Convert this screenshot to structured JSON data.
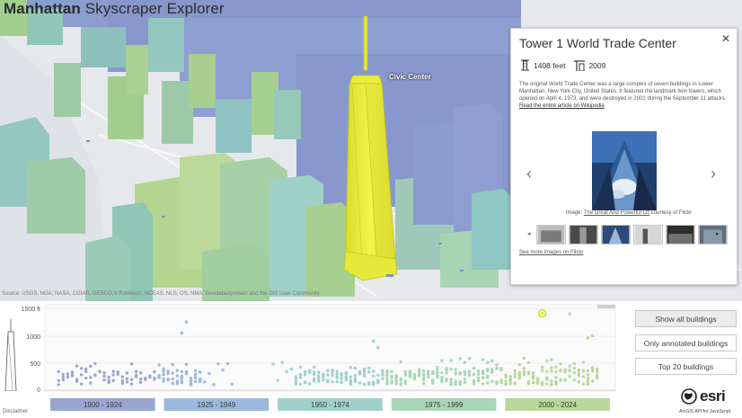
{
  "header": {
    "title_bold": "Manhattan",
    "title_rest": "Skyscraper Explorer"
  },
  "map": {
    "landmark_label": "Civic Center",
    "attribution": "Source: USGS, NGA, NASA, CGIAR, GEBCO,N Robinson, NCEAS, NLS, OS, NMA, Geodatastyrelsen and the GIS User Community",
    "colors": {
      "highlight": "#e9ec3c",
      "building_blue": "#8a9bd0",
      "building_teal": "#8fc6c1",
      "building_green": "#a9cf95",
      "ground": "#e9ebee"
    }
  },
  "popup": {
    "title": "Tower 1 World Trade Center",
    "close_icon": "close-icon",
    "height_text": "1408 feet",
    "year_text": "2009",
    "description": "The original World Trade Center was a large complex of seven buildings in Lower Manhattan, New York City, United States. It featured the landmark twin towers, which opened on April 4, 1973, and were destroyed in 2001 during the September 11 attacks.",
    "read_more": "Read the entire article on Wikipedia",
    "caption_prefix": "Image:",
    "caption_title": "The Great And Powerful Oz",
    "caption_suffix": "courtesy of Flickr",
    "more_images": "See more images on Flickr"
  },
  "timeline": {
    "y_ticks": [
      "1500 ft",
      "1000",
      "500",
      "0"
    ],
    "periods": [
      {
        "label": "1900 - 1924",
        "color": "#9aa6d0"
      },
      {
        "label": "1925 - 1949",
        "color": "#9cb8dc"
      },
      {
        "label": "1950 - 1974",
        "color": "#9fd0cc"
      },
      {
        "label": "1975 - 1999",
        "color": "#a9d6b6"
      },
      {
        "label": "2000 - 2024",
        "color": "#b8d89a"
      }
    ],
    "selected_year": 2009,
    "selected_height": 1408,
    "disclaimer": "Disclaimer"
  },
  "filters": {
    "show_all": "Show all buildings",
    "annotated": "Only annotated buildings",
    "top20": "Top 20 buildings"
  },
  "branding": {
    "logo_text": "esri",
    "sub_text": "ArcGIS API for JavaScript"
  }
}
